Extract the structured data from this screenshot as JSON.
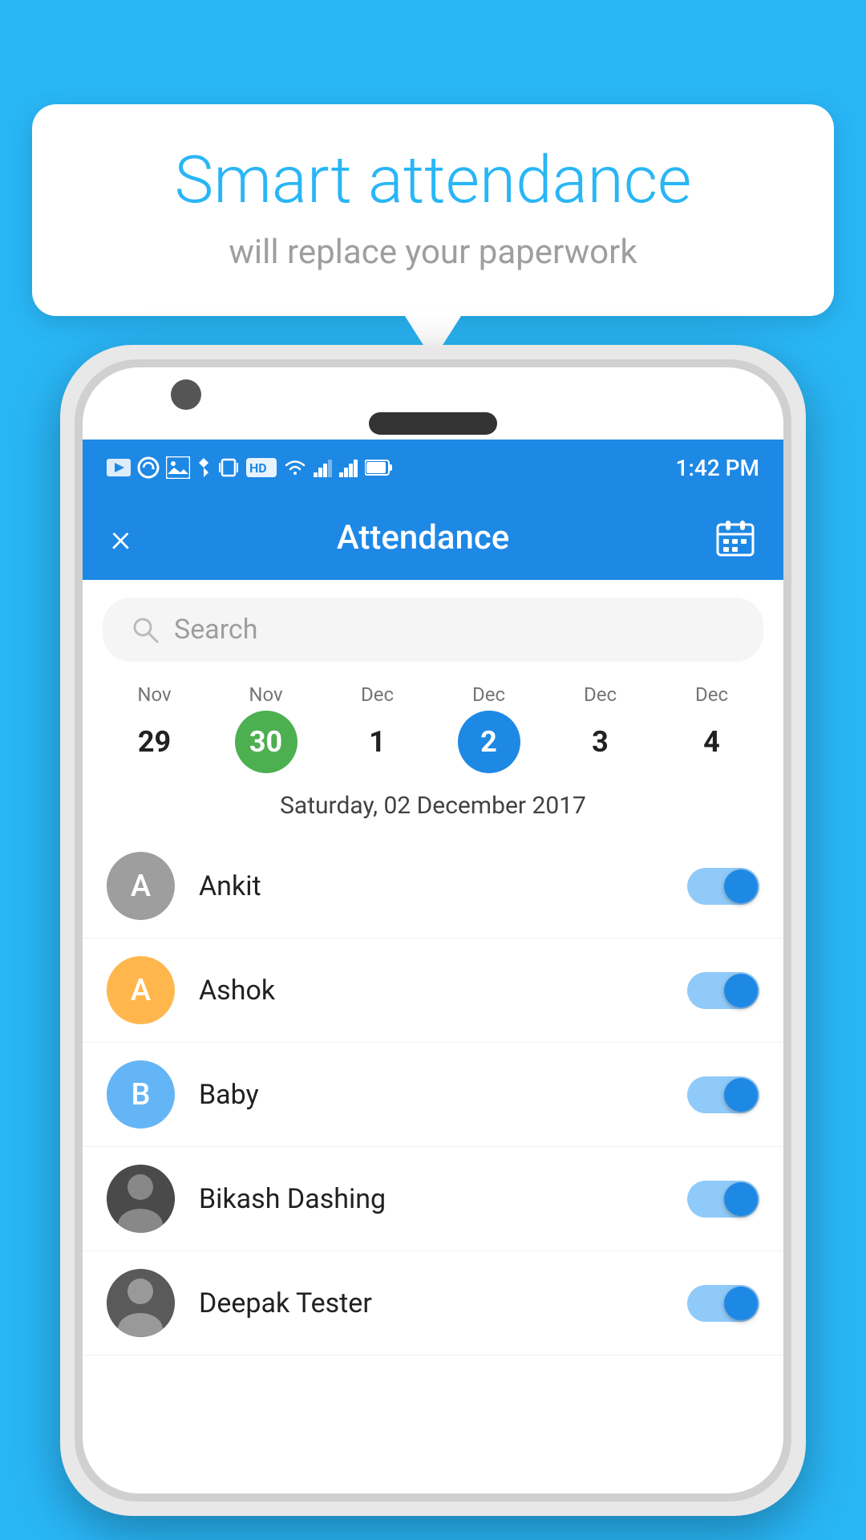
{
  "background_color": "#29b6f6",
  "speech_bubble": {
    "title": "Smart attendance",
    "subtitle": "will replace your paperwork"
  },
  "status_bar": {
    "time": "1:42 PM",
    "signal_icons": [
      "bluetooth",
      "vibrate",
      "hd",
      "wifi",
      "signal1",
      "signal2",
      "battery"
    ]
  },
  "app_header": {
    "title": "Attendance",
    "close_label": "×",
    "calendar_icon": "calendar"
  },
  "search": {
    "placeholder": "Search"
  },
  "dates": [
    {
      "month": "Nov",
      "day": "29",
      "state": "normal"
    },
    {
      "month": "Nov",
      "day": "30",
      "state": "today"
    },
    {
      "month": "Dec",
      "day": "1",
      "state": "normal"
    },
    {
      "month": "Dec",
      "day": "2",
      "state": "selected"
    },
    {
      "month": "Dec",
      "day": "3",
      "state": "normal"
    },
    {
      "month": "Dec",
      "day": "4",
      "state": "normal"
    }
  ],
  "selected_date_label": "Saturday, 02 December 2017",
  "attendance_list": [
    {
      "name": "Ankit",
      "avatar_letter": "A",
      "avatar_type": "letter",
      "avatar_color": "gray",
      "present": true
    },
    {
      "name": "Ashok",
      "avatar_letter": "A",
      "avatar_type": "letter",
      "avatar_color": "orange",
      "present": true
    },
    {
      "name": "Baby",
      "avatar_letter": "B",
      "avatar_type": "letter",
      "avatar_color": "blue",
      "present": true
    },
    {
      "name": "Bikash Dashing",
      "avatar_letter": "",
      "avatar_type": "photo",
      "avatar_color": "dark",
      "present": true
    },
    {
      "name": "Deepak Tester",
      "avatar_letter": "",
      "avatar_type": "photo",
      "avatar_color": "dark2",
      "present": true
    }
  ]
}
